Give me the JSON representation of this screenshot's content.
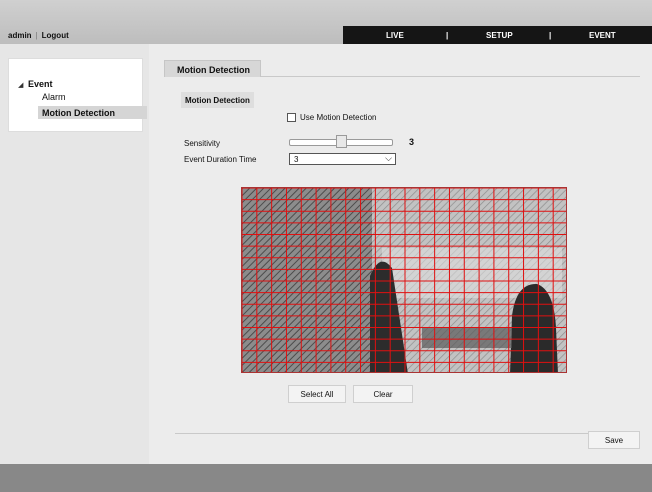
{
  "header": {
    "user": "admin",
    "separator": "|",
    "logout": "Logout",
    "nav": [
      {
        "label": "LIVE"
      },
      {
        "label": "|"
      },
      {
        "label": "SETUP"
      },
      {
        "label": "|"
      },
      {
        "label": "EVENT"
      }
    ]
  },
  "sidebar": {
    "root": "Event",
    "items": [
      {
        "label": "Alarm"
      },
      {
        "label": "Motion Detection"
      }
    ]
  },
  "main": {
    "tab": "Motion Detection",
    "section_title": "Motion Detection",
    "use_motion_label": "Use Motion Detection",
    "use_motion_checked": false,
    "sensitivity_label": "Sensitivity",
    "sensitivity_value": "3",
    "sensitivity_fraction": 0.5,
    "duration_label": "Event Duration Time",
    "duration_value": "3",
    "select_all": "Select All",
    "clear": "Clear",
    "save": "Save"
  },
  "motion_grid": {
    "columns": 22,
    "rows": 16,
    "line_color": "#e01010",
    "active_hatch_color": "#555555"
  },
  "colors": {
    "nav_bg": "#151515",
    "header_bg": "#c8c8c8",
    "footer_bg": "#888888"
  }
}
